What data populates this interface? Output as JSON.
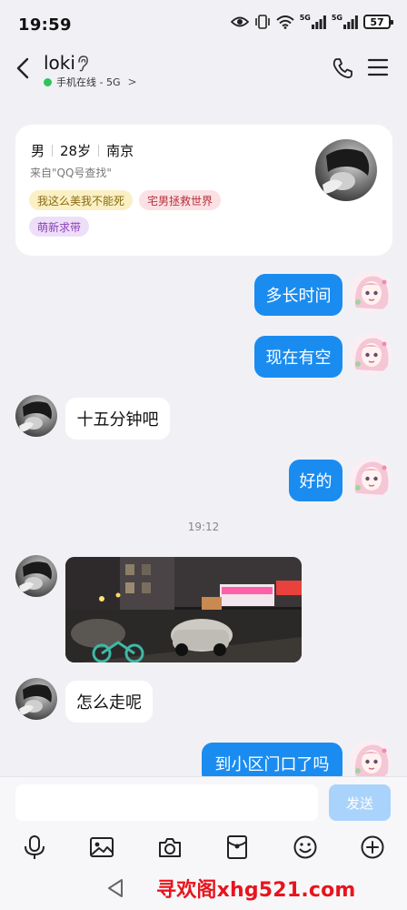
{
  "status_bar": {
    "time": "19:59",
    "network_1": "5G",
    "network_2": "5G",
    "battery": "57"
  },
  "header": {
    "contact_name": "loki",
    "online_status": "手机在线 - 5G",
    "online_chevron": ">"
  },
  "profile": {
    "gender": "男",
    "age": "28岁",
    "city": "南京",
    "source": "来自\"QQ号查找\"",
    "tags": [
      {
        "label": "我这么美我不能死",
        "bg": "#fbf0c4",
        "fg": "#8a6a12"
      },
      {
        "label": "宅男拯救世界",
        "bg": "#fbe1e4",
        "fg": "#b4323f"
      },
      {
        "label": "萌新求带",
        "bg": "#eedff8",
        "fg": "#8a3fb5"
      }
    ]
  },
  "messages": [
    {
      "side": "out",
      "text": "多长时间"
    },
    {
      "side": "out",
      "text": "现在有空"
    },
    {
      "side": "in",
      "text": "十五分钟吧"
    },
    {
      "side": "out",
      "text": "好的"
    },
    {
      "side": "time",
      "text": "19:12"
    },
    {
      "side": "in",
      "type": "image"
    },
    {
      "side": "in",
      "text": "怎么走呢"
    },
    {
      "side": "out",
      "text": "到小区门口了吗"
    }
  ],
  "composer": {
    "input_value": "",
    "send_label": "发送"
  },
  "toolbar_icons": [
    "microphone-icon",
    "image-icon",
    "camera-icon",
    "red-packet-icon",
    "emoji-icon",
    "plus-icon"
  ],
  "watermark": "寻欢阁xhg521.com",
  "colors": {
    "accent": "#1a8cf0",
    "background": "#f1f1f5",
    "online": "#2ec45a",
    "watermark": "#e8141c"
  }
}
